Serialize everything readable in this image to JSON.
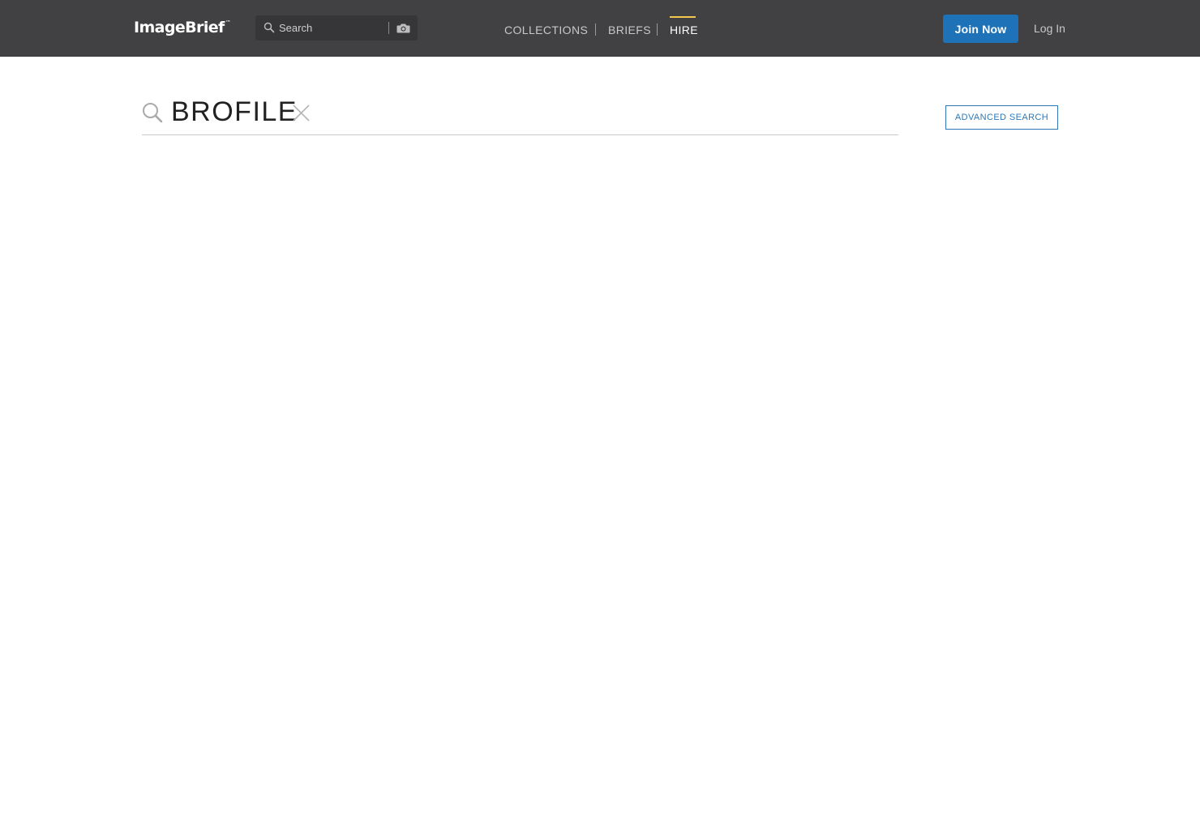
{
  "header": {
    "logo": {
      "text": "ImageBrief",
      "tm": "™"
    },
    "search": {
      "placeholder": "Search",
      "value": ""
    },
    "nav": [
      {
        "label": "COLLECTIONS",
        "active": false
      },
      {
        "label": "BRIEFS",
        "active": false
      },
      {
        "label": "HIRE",
        "active": true
      }
    ],
    "join_label": "Join Now",
    "login_label": "Log In"
  },
  "main": {
    "query": "BROFILE",
    "advanced_search_label": "ADVANCED SEARCH"
  },
  "colors": {
    "topbar": "#414042",
    "accent_blue": "#1d72b8",
    "nav_underline": "#f2c94c"
  },
  "icons": [
    "search-icon",
    "camera-icon",
    "magnifier-icon",
    "close-icon"
  ]
}
